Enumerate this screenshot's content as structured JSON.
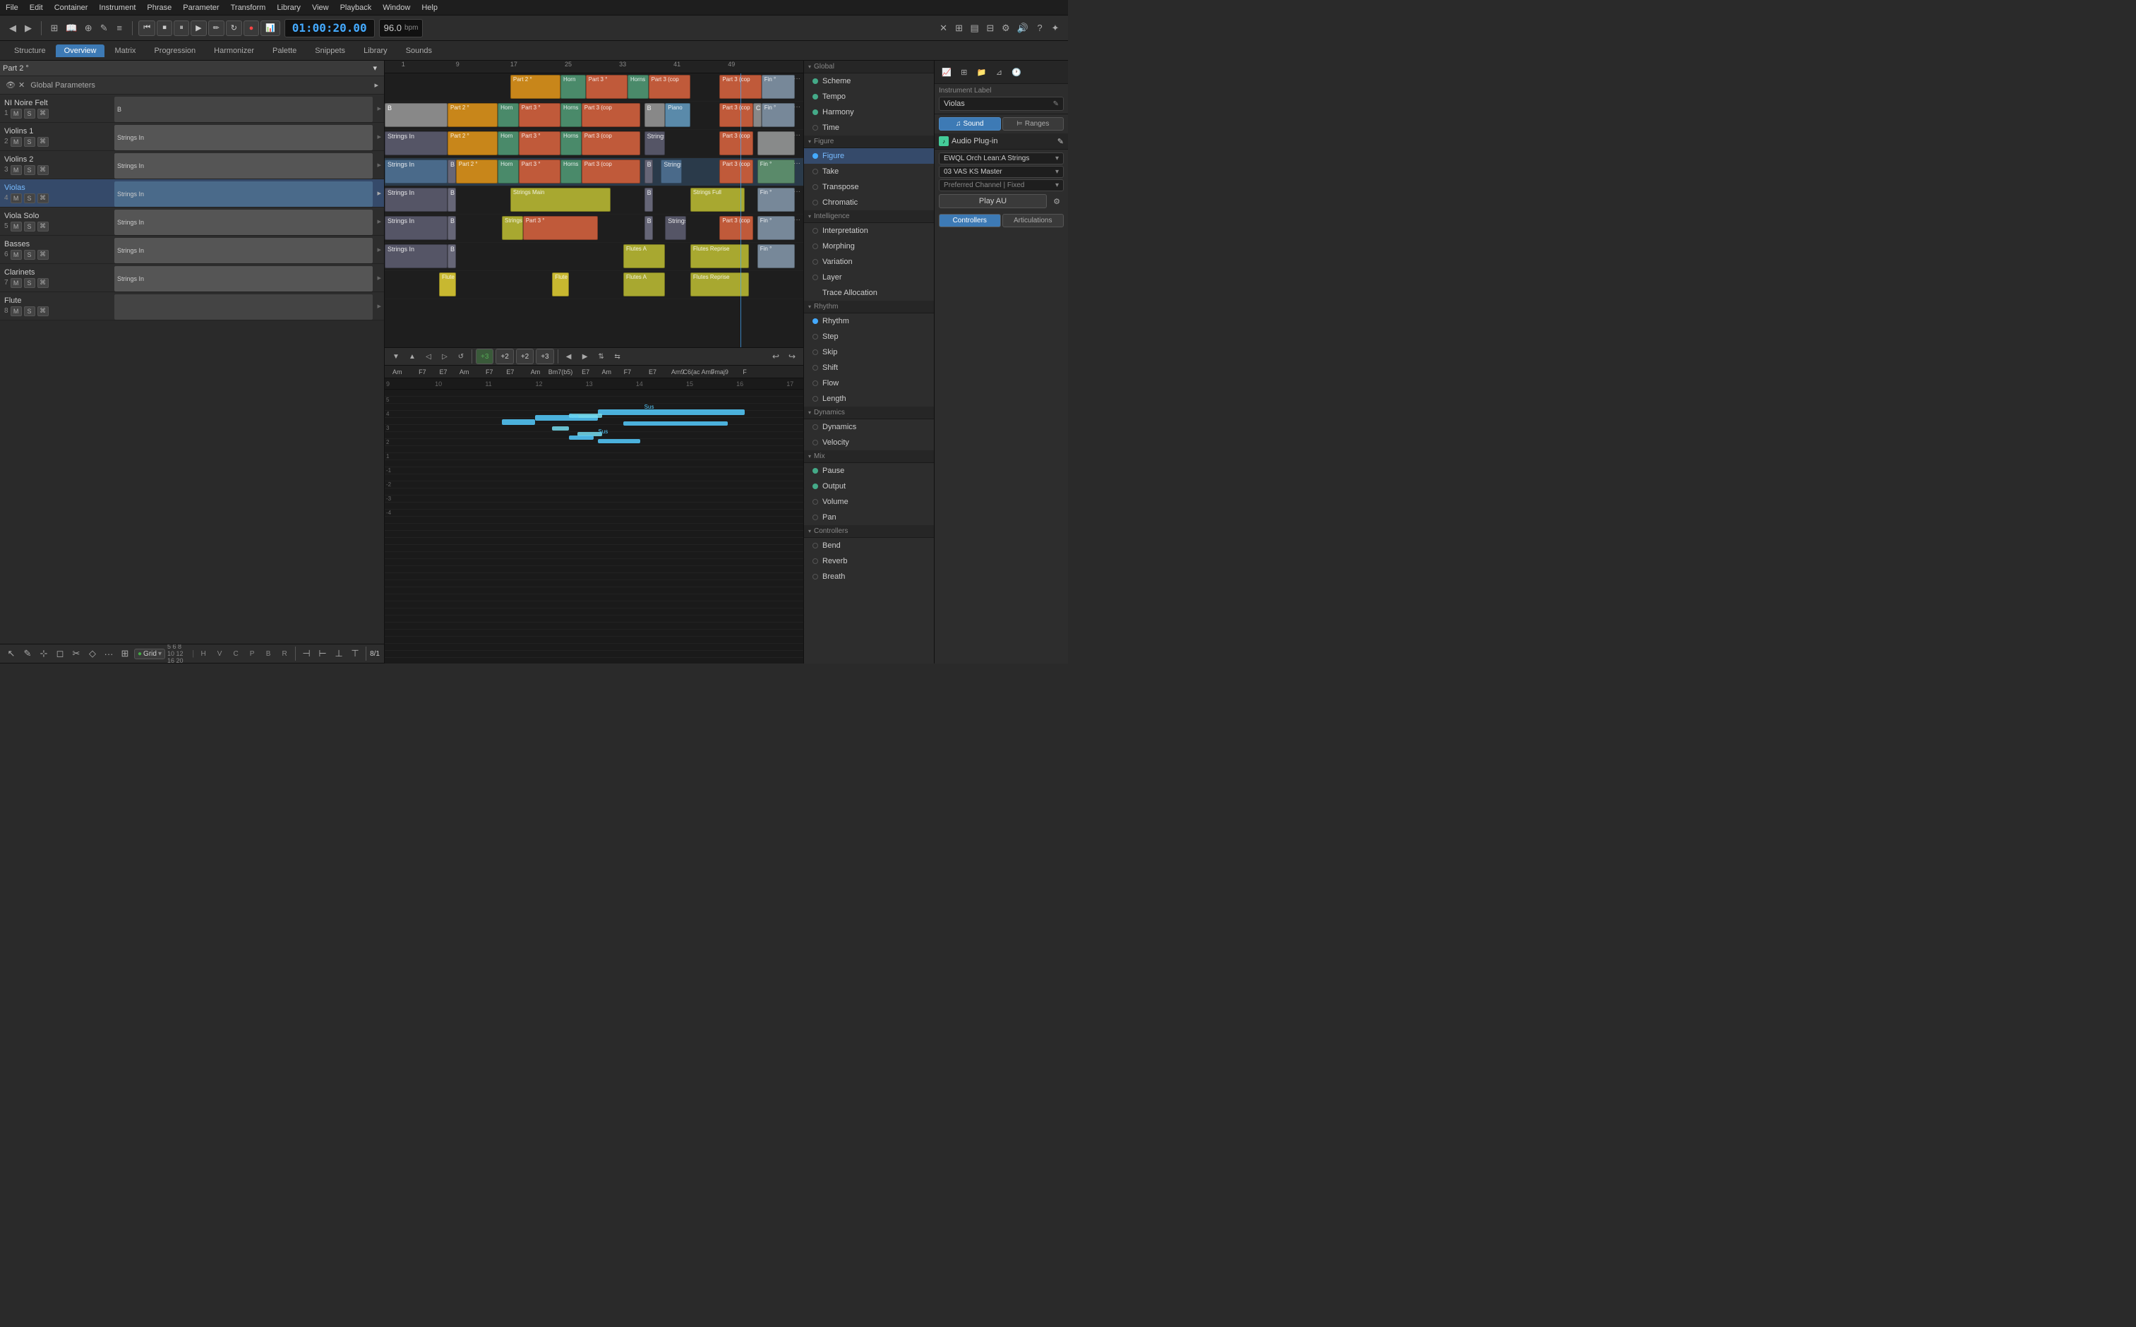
{
  "app": {
    "title": "Rapid Composer"
  },
  "menu": {
    "items": [
      "File",
      "Edit",
      "Container",
      "Instrument",
      "Phrase",
      "Parameter",
      "Transform",
      "Library",
      "View",
      "Playback",
      "Window",
      "Help"
    ]
  },
  "toolbar": {
    "time": "01:00:20.00",
    "bpm": "96.0",
    "bpm_label": "bpm"
  },
  "tabs": {
    "items": [
      "Structure",
      "Overview",
      "Matrix",
      "Progression",
      "Harmonizer",
      "Palette",
      "Snippets",
      "Library",
      "Sounds"
    ],
    "active": "Overview"
  },
  "part_label": "Part 2 °",
  "global": {
    "label": "Global",
    "scheme": "Scheme",
    "tempo": "Tempo",
    "harmony": "Harmony",
    "time": "Time"
  },
  "figure": {
    "label": "Figure",
    "figure": "Figure",
    "take": "Take",
    "transpose": "Transpose",
    "chromatic": "Chromatic"
  },
  "intelligence": {
    "label": "Intelligence",
    "interpretation": "Interpretation",
    "morphing": "Morphing",
    "variation": "Variation",
    "layer": "Layer",
    "trace_allocation": "Trace Allocation"
  },
  "rhythm": {
    "label": "Rhythm",
    "rhythm": "Rhythm",
    "step": "Step",
    "skip": "Skip",
    "shift": "Shift",
    "flow": "Flow",
    "length": "Length"
  },
  "dynamics_section": {
    "label": "Dynamics",
    "dynamics": "Dynamics",
    "velocity": "Velocity"
  },
  "mix": {
    "label": "Mix",
    "pause": "Pause",
    "output": "Output",
    "volume": "Volume",
    "pan": "Pan"
  },
  "controllers": {
    "label": "Controllers",
    "bend": "Bend",
    "reverb": "Reverb",
    "breath": "Breath"
  },
  "instrument_panel": {
    "instrument_label": "Instrument Label",
    "violas": "Violas",
    "sound_tab": "Sound",
    "ranges_tab": "Ranges",
    "audio_plugin": "Audio Plug-in",
    "ewql_dropdown": "EWQL Orch Lean:A Strings",
    "vas_dropdown": "03 VAS KS Master",
    "preferred_channel": "Preferred Channel | Fixed",
    "play_au": "Play AU",
    "controllers_tab": "Controllers",
    "articulations_tab": "Articulations"
  },
  "tracks": [
    {
      "name": "NI Noire Felt",
      "num": "1",
      "controls": [
        "M",
        "S",
        "⌘"
      ],
      "color": "#888"
    },
    {
      "name": "Violins 1",
      "num": "2",
      "controls": [
        "M",
        "S",
        "⌘"
      ],
      "color": "#5a8"
    },
    {
      "name": "Violins 2",
      "num": "3",
      "controls": [
        "M",
        "S",
        "⌘"
      ],
      "color": "#5a8"
    },
    {
      "name": "Violas",
      "num": "4",
      "controls": [
        "M",
        "S",
        "⌘"
      ],
      "color": "#5af",
      "selected": true
    },
    {
      "name": "Viola Solo",
      "num": "5",
      "controls": [
        "M",
        "S",
        "⌘"
      ],
      "color": "#a85"
    },
    {
      "name": "Basses",
      "num": "6",
      "controls": [
        "M",
        "S",
        "⌘"
      ],
      "color": "#888"
    },
    {
      "name": "Clarinets",
      "num": "7",
      "controls": [
        "M",
        "S",
        "⌘"
      ],
      "color": "#888"
    },
    {
      "name": "Flute",
      "num": "8",
      "controls": [
        "M",
        "S",
        "⌘"
      ],
      "color": "#888"
    }
  ],
  "ruler_marks": [
    "1",
    "9",
    "17",
    "25",
    "33",
    "41",
    "49"
  ],
  "chords": [
    {
      "label": "Am",
      "pos": "3%"
    },
    {
      "label": "F7",
      "pos": "9%"
    },
    {
      "label": "E7",
      "pos": "14%"
    },
    {
      "label": "Am",
      "pos": "19%"
    },
    {
      "label": "F7",
      "pos": "25%"
    },
    {
      "label": "E7",
      "pos": "30%"
    },
    {
      "label": "Am",
      "pos": "36%"
    },
    {
      "label": "Bm7(b5)",
      "pos": "42%"
    },
    {
      "label": "E7",
      "pos": "47%"
    },
    {
      "label": "Am",
      "pos": "53%"
    },
    {
      "label": "F7",
      "pos": "58%"
    },
    {
      "label": "E7",
      "pos": "64%"
    },
    {
      "label": "Am9",
      "pos": "70%"
    },
    {
      "label": "C6(ac Am9",
      "pos": "75%"
    },
    {
      "label": "Fmaj9",
      "pos": "80%"
    },
    {
      "label": "F",
      "pos": "86%"
    }
  ],
  "beat_marks": [
    "9",
    "10",
    "11",
    "12",
    "13",
    "14",
    "15",
    "16",
    "17"
  ]
}
